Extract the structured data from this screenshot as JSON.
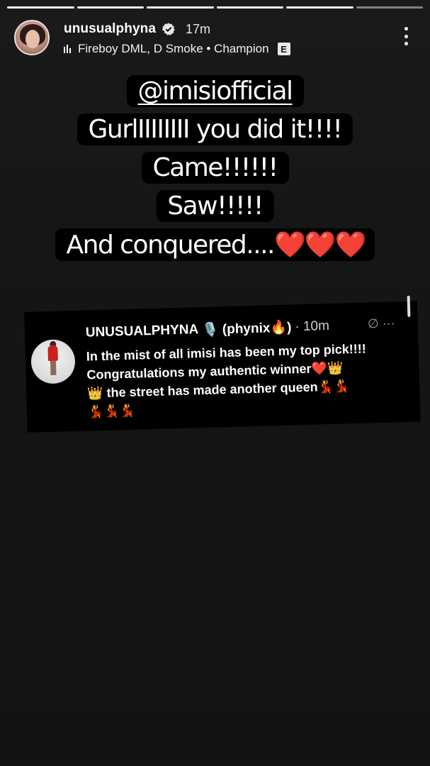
{
  "story": {
    "progress_segments": 6,
    "active_segment": 6
  },
  "header": {
    "username": "unusualphyna",
    "time": "17m",
    "music": "Fireboy DML, D Smoke • Champion",
    "explicit_badge": "E"
  },
  "story_text": {
    "mention": "@imisiofficial",
    "line2": "GurlIIIIIIII you did it!!!!",
    "line3": "Came!!!!!!",
    "line4": "Saw!!!!!",
    "line5": "And conquered....",
    "hearts": "❤️❤️❤️"
  },
  "post_card": {
    "name": "UNUSUALPHYNA",
    "mic_emoji": "🎙️",
    "nickname": "(phynix🔥)",
    "time": "· 10m",
    "icons_text": "∅ ···",
    "line1": "In the mist of all imisi has been my top pick!!!!",
    "line2": "Congratulations my authentic winner",
    "line2_emojis": "❤️👑",
    "line3": "👑 the street has made another queen💃💃",
    "line4": "💃💃💃"
  }
}
